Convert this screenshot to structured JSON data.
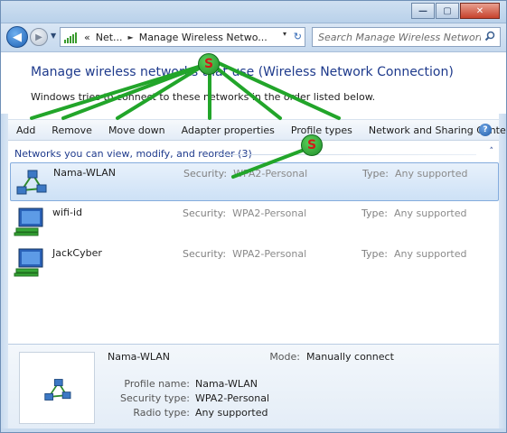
{
  "window": {
    "controls": {
      "minimize": "—",
      "maximize": "▢",
      "close": "✕"
    }
  },
  "address": {
    "history_chevron": "«",
    "crumbs": [
      "Net...",
      "Manage Wireless Netwo..."
    ],
    "separator": "►",
    "dropdown": "▾",
    "refresh": "↻"
  },
  "search": {
    "placeholder": "Search Manage Wireless Networks"
  },
  "header": {
    "title": "Manage wireless networks that use (Wireless Network Connection)",
    "description": "Windows tries to connect to these networks in the order listed below."
  },
  "toolbar": {
    "items": [
      "Add",
      "Remove",
      "Move down",
      "Adapter properties",
      "Profile types",
      "Network and Sharing Center"
    ],
    "help": "?"
  },
  "group": {
    "label": "Networks you can view, modify, and reorder (3)",
    "collapse_glyph": "˄"
  },
  "networks": [
    {
      "name": "Nama-WLAN",
      "security_label": "Security:",
      "security": "WPA2-Personal",
      "type_label": "Type:",
      "type": "Any supported",
      "selected": true
    },
    {
      "name": "wifi-id",
      "security_label": "Security:",
      "security": "WPA2-Personal",
      "type_label": "Type:",
      "type": "Any supported",
      "selected": false
    },
    {
      "name": "JackCyber",
      "security_label": "Security:",
      "security": "WPA2-Personal",
      "type_label": "Type:",
      "type": "Any supported",
      "selected": false
    }
  ],
  "details": {
    "name": "Nama-WLAN",
    "mode_label": "Mode:",
    "mode": "Manually connect",
    "fields": [
      {
        "label": "Profile name:",
        "value": "Nama-WLAN"
      },
      {
        "label": "Security type:",
        "value": "WPA2-Personal"
      },
      {
        "label": "Radio type:",
        "value": "Any supported"
      }
    ]
  },
  "annotations": {
    "badge_letter": "S"
  },
  "colors": {
    "title_blue": "#1e3a8c",
    "selection": "#cde1f6",
    "annotation_green": "#22a52a",
    "annotation_letter": "#d11a1a"
  }
}
